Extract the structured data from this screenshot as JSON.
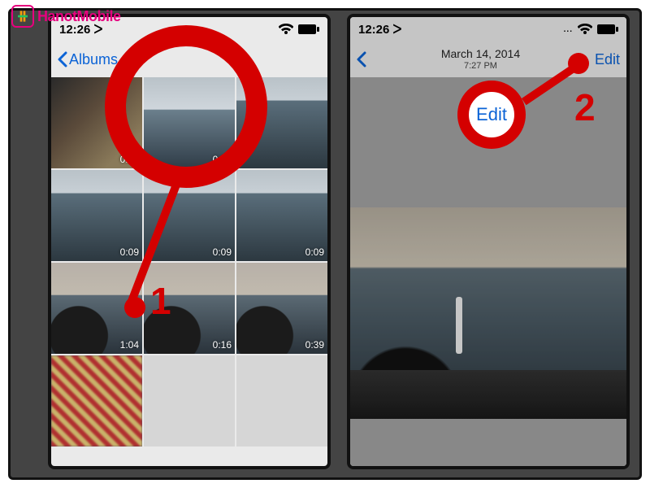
{
  "logo_text": "HanotMobile",
  "colors": {
    "accent": "#0b63d6",
    "annotation": "#d40000",
    "brand": "#e6007e"
  },
  "left": {
    "status_time": "12:26 ᐳ",
    "back_label": "Albums",
    "thumbs": [
      {
        "kind": "room",
        "duration": "0:37"
      },
      {
        "kind": "sea-sky",
        "duration": "0:16",
        "highlighted": true
      },
      {
        "kind": "sea",
        "duration": ""
      },
      {
        "kind": "sea",
        "duration": "0:09"
      },
      {
        "kind": "sea",
        "duration": "0:09"
      },
      {
        "kind": "sea",
        "duration": "0:09"
      },
      {
        "kind": "rocks",
        "duration": "1:04"
      },
      {
        "kind": "rocks",
        "duration": "0:16"
      },
      {
        "kind": "rocks",
        "duration": "0:39"
      },
      {
        "kind": "pattern",
        "duration": ""
      },
      {
        "kind": "blank",
        "duration": ""
      },
      {
        "kind": "blank",
        "duration": ""
      }
    ]
  },
  "right": {
    "status_time": "12:26 ᐳ",
    "edit_label": "Edit",
    "date": "March 14, 2014",
    "time": "7:27 PM",
    "edit_bubble_label": "Edit"
  },
  "annotations": {
    "step1": "1",
    "step2": "2"
  }
}
